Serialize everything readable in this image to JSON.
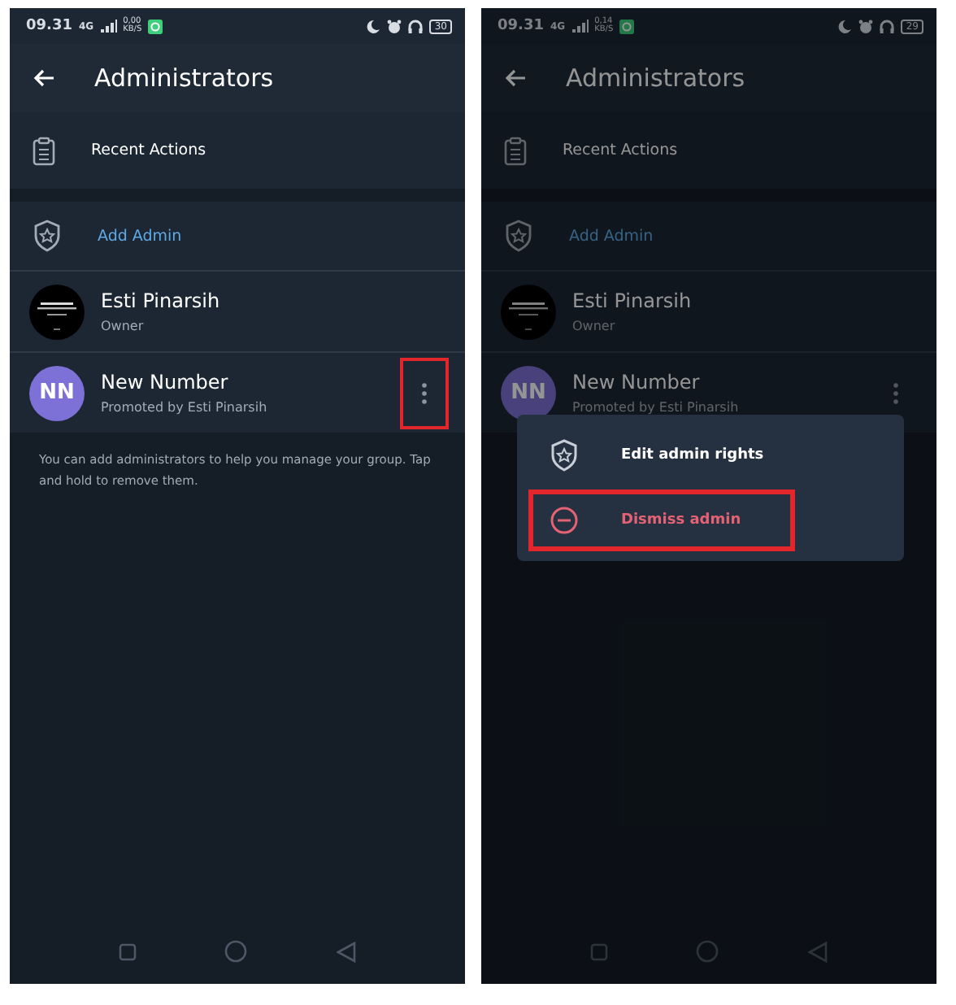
{
  "screens": [
    {
      "dimmed": false,
      "status": {
        "time": "09.31",
        "network": "4G",
        "speed": "0,00",
        "speed_unit": "KB/S",
        "battery": "30"
      },
      "title": "Administrators",
      "recent_actions": "Recent Actions",
      "add_admin": "Add Admin",
      "admins": [
        {
          "name": "Esti Pinarsih",
          "role": "Owner"
        },
        {
          "name": "New Number",
          "role": "Promoted by Esti Pinarsih",
          "avatar": {
            "kind": "initials",
            "initials": "NN"
          },
          "menu_button": {
            "highlighted": true
          }
        }
      ],
      "help_text": "You can add administrators to help you manage your group. Tap and hold to remove them."
    },
    {
      "dimmed": true,
      "status": {
        "time": "09.31",
        "network": "4G",
        "speed": "0,14",
        "speed_unit": "KB/S",
        "battery": "29"
      },
      "title": "Administrators",
      "recent_actions": "Recent Actions",
      "add_admin": "Add Admin",
      "admins": [
        {
          "name": "Esti Pinarsih",
          "role": "Owner"
        },
        {
          "name": "New Number",
          "role": "Promoted by Esti Pinarsih",
          "avatar": {
            "kind": "initials",
            "initials": "NN"
          },
          "menu_button": {
            "highlighted": false
          }
        }
      ],
      "popup_menu": [
        {
          "kind": "edit",
          "label": "Edit admin rights",
          "highlighted": false
        },
        {
          "kind": "dismiss",
          "label": "Dismiss admin",
          "highlighted": true
        }
      ]
    }
  ]
}
